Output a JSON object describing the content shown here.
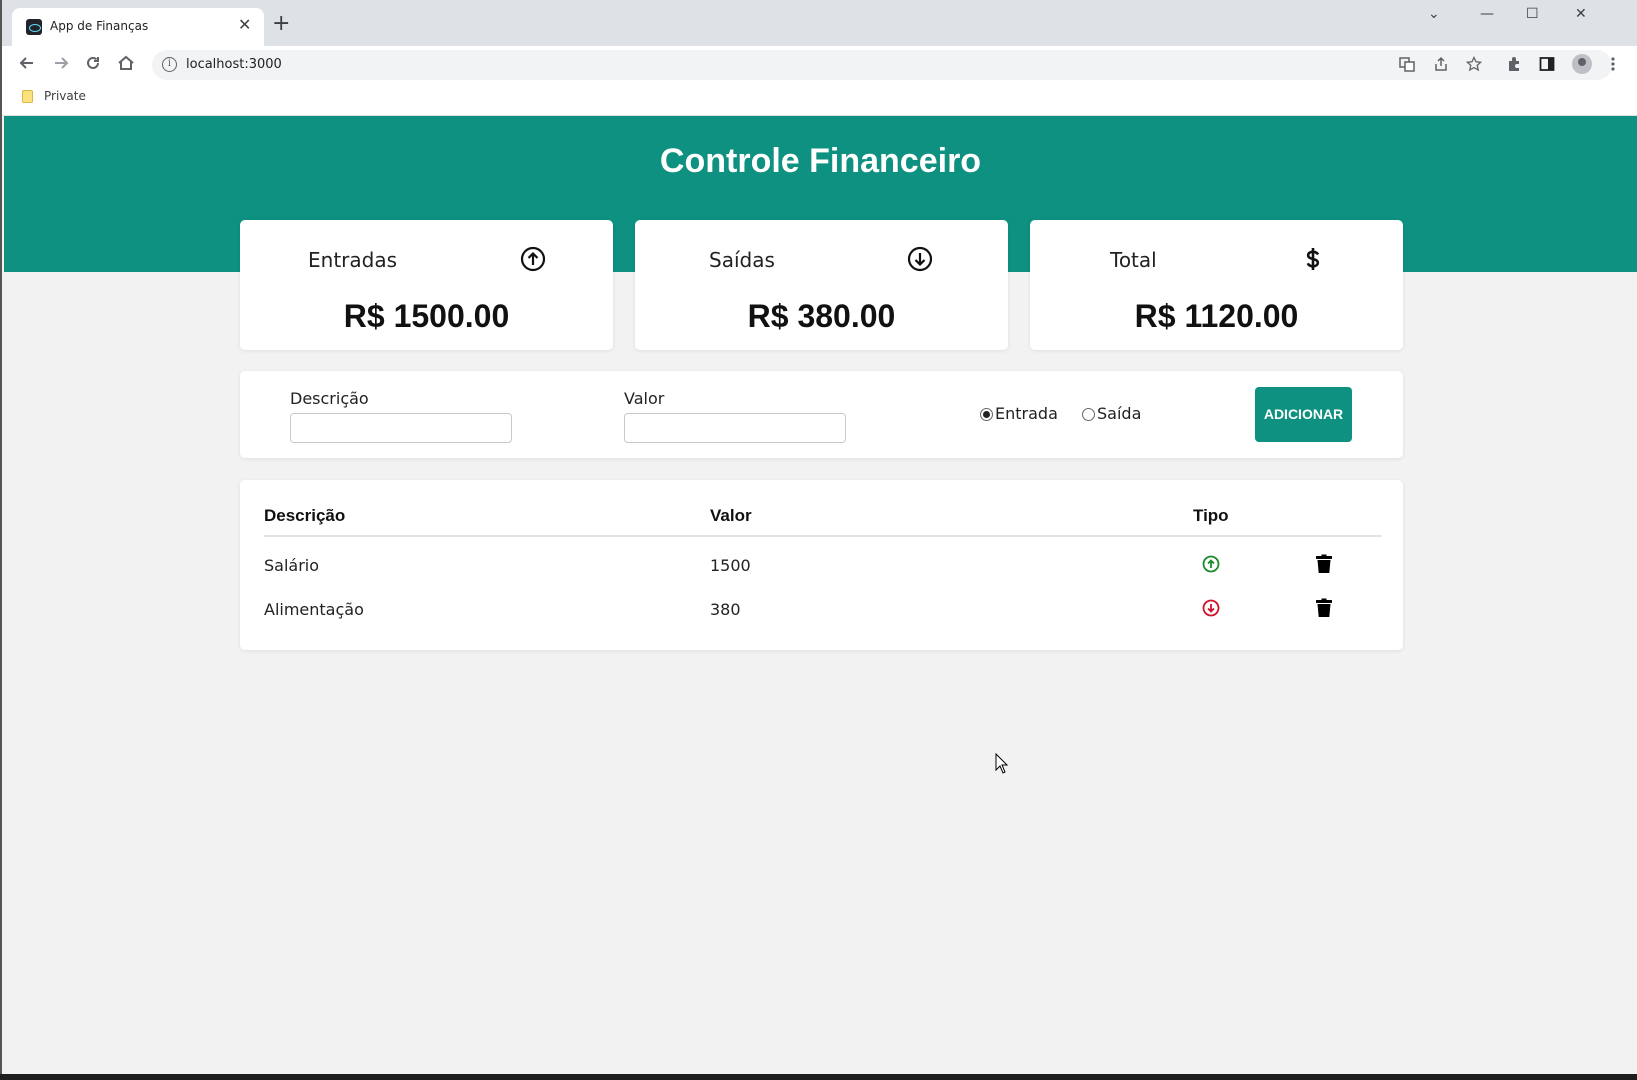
{
  "browser": {
    "tab_title": "App de Finanças",
    "tab_close": "✕",
    "new_tab": "+",
    "url": "localhost:3000",
    "bookmark_label": "Private",
    "window_controls": {
      "minimize": "—",
      "maximize": "☐",
      "close": "✕",
      "tab_search": "⌄"
    }
  },
  "app": {
    "title": "Controle Financeiro",
    "cards": [
      {
        "label": "Entradas",
        "value": "R$ 1500.00",
        "icon": "arrow-up-circle-icon"
      },
      {
        "label": "Saídas",
        "value": "R$ 380.00",
        "icon": "arrow-down-circle-icon"
      },
      {
        "label": "Total",
        "value": "R$ 1120.00",
        "icon": "dollar-icon"
      }
    ],
    "form": {
      "description_label": "Descrição",
      "description_value": "",
      "value_label": "Valor",
      "value_value": "",
      "radio_entrada": "Entrada",
      "radio_saida": "Saída",
      "selected_type": "Entrada",
      "add_button": "ADICIONAR"
    },
    "table": {
      "headers": [
        "Descrição",
        "Valor",
        "Tipo"
      ],
      "rows": [
        {
          "description": "Salário",
          "value": "1500",
          "type": "entrada"
        },
        {
          "description": "Alimentação",
          "value": "380",
          "type": "saida"
        }
      ]
    }
  },
  "colors": {
    "brand": "#0e9180",
    "income": "#1a8a2a",
    "expense": "#d0132a"
  }
}
